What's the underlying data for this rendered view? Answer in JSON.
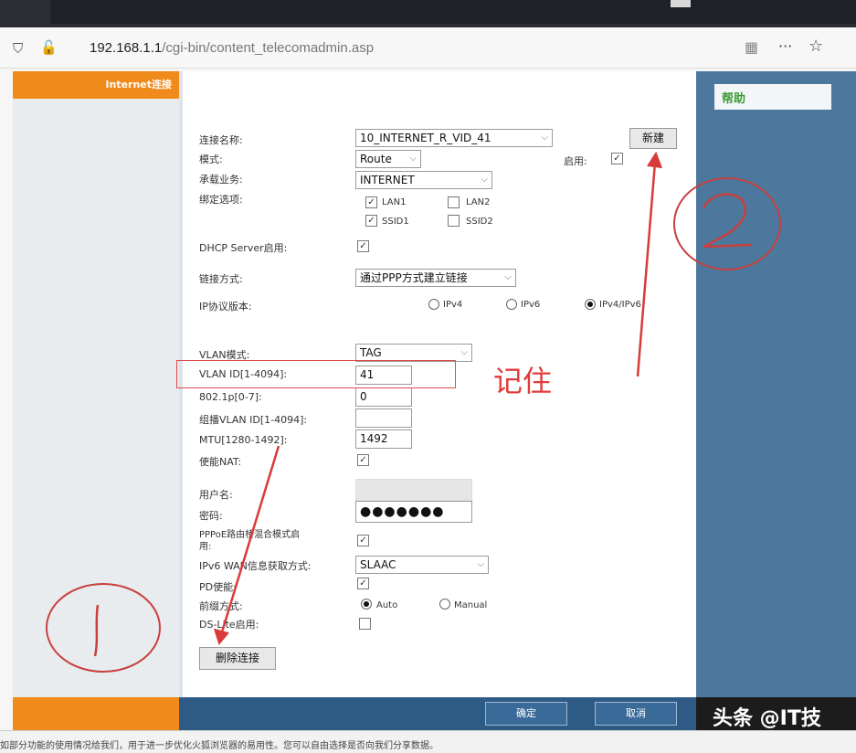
{
  "browser": {
    "url_host": "192.168.1.1",
    "url_path": "/cgi-bin/content_telecomadmin.asp"
  },
  "nav": {
    "active_label": "Internet连接"
  },
  "help": {
    "title": "帮助"
  },
  "form": {
    "conn_name_label": "连接名称:",
    "conn_name_value": "10_INTERNET_R_VID_41",
    "new_button": "新建",
    "mode_label": "模式:",
    "mode_value": "Route",
    "enable_label": "启用:",
    "service_label": "承载业务:",
    "service_value": "INTERNET",
    "bind_label": "绑定选项:",
    "bind_options": [
      "LAN1",
      "LAN2",
      "SSID1",
      "SSID2"
    ],
    "dhcp_label": "DHCP Server启用:",
    "link_label": "链接方式:",
    "link_value": "通过PPP方式建立链接",
    "ip_version_label": "IP协议版本:",
    "ip_versions": [
      "IPv4",
      "IPv6",
      "IPv4/IPv6"
    ],
    "vlan_mode_label": "VLAN模式:",
    "vlan_mode_value": "TAG",
    "vlan_id_label": "VLAN ID[1-4094]:",
    "vlan_id_value": "41",
    "p8021_label": "802.1p[0-7]:",
    "p8021_value": "0",
    "mcast_vlan_label": "组播VLAN ID[1-4094]:",
    "mcast_vlan_value": "",
    "mtu_label": "MTU[1280-1492]:",
    "mtu_value": "1492",
    "nat_label": "使能NAT:",
    "username_label": "用户名:",
    "password_label": "密码:",
    "password_value": "●●●●●●●",
    "pppoe_bridge_label_1": "PPPoE路由桥混合模式启",
    "pppoe_bridge_label_2": "用:",
    "ipv6_wan_label": "IPv6 WAN信息获取方式:",
    "ipv6_wan_value": "SLAAC",
    "pd_label": "PD使能:",
    "prefix_label": "前缀方式:",
    "prefix_options": [
      "Auto",
      "Manual"
    ],
    "dslite_label": "DS-Lite启用:",
    "delete_button": "删除连接"
  },
  "footer": {
    "ok": "确定",
    "cancel": "取消"
  },
  "annotations": {
    "remember": "记住",
    "circle_1": "1",
    "circle_2": "2"
  },
  "watermark": "头条 @IT技",
  "status_text": "如部分功能的使用情况给我们，用于进一步优化火狐浏览器的易用性。您可以自由选择是否向我们分享数据。",
  "colors": {
    "orange": "#f08a1a",
    "blue": "#4d789d",
    "red": "#e23a3a"
  }
}
